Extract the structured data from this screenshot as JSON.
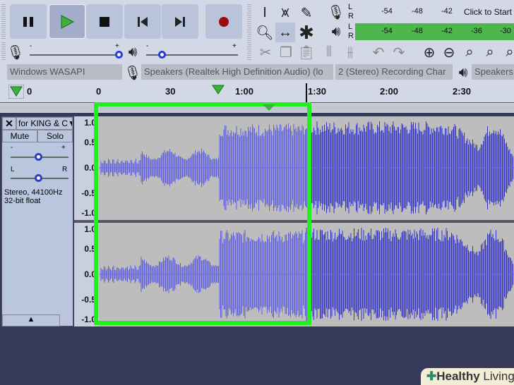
{
  "transport": {
    "pause": "pause",
    "play": "play",
    "stop": "stop",
    "skip_start": "skip-to-start",
    "skip_end": "skip-to-end",
    "record": "record"
  },
  "meters": {
    "record_ticks": [
      "-54",
      "-48",
      "-42"
    ],
    "record_prompt": "Click to Start M",
    "play_ticks": [
      "-54",
      "-48",
      "-42",
      "-36",
      "-30"
    ],
    "L": "L",
    "R": "R"
  },
  "sliders": {
    "minus": "-",
    "plus": "+",
    "record_volume": 1.0,
    "playback_volume": 0.15
  },
  "devices": {
    "host": "Windows WASAPI",
    "recording": "Speakers (Realtek High Definition Audio) (lo",
    "channels": "2 (Stereo) Recording Char",
    "playback": "Speakers ("
  },
  "ruler": {
    "ticks": [
      "0",
      "0",
      "30",
      "1:00",
      "1:30",
      "2:00",
      "2:30"
    ]
  },
  "track": {
    "name": "for KING & C",
    "mute": "Mute",
    "solo": "Solo",
    "gain_minus": "-",
    "gain_plus": "+",
    "pan_l": "L",
    "pan_r": "R",
    "info1": "Stereo, 44100Hz",
    "info2": "32-bit float",
    "axis": [
      "1.0",
      "0.5",
      "0.0",
      "-0.5",
      "-1.0"
    ]
  },
  "watermark": {
    "text_bold": "Healthy",
    "text": "Living"
  },
  "colors": {
    "selection_highlight": "#22ee22",
    "waveform": "#3434c8",
    "waveform_selected": "#5f5fe0"
  }
}
